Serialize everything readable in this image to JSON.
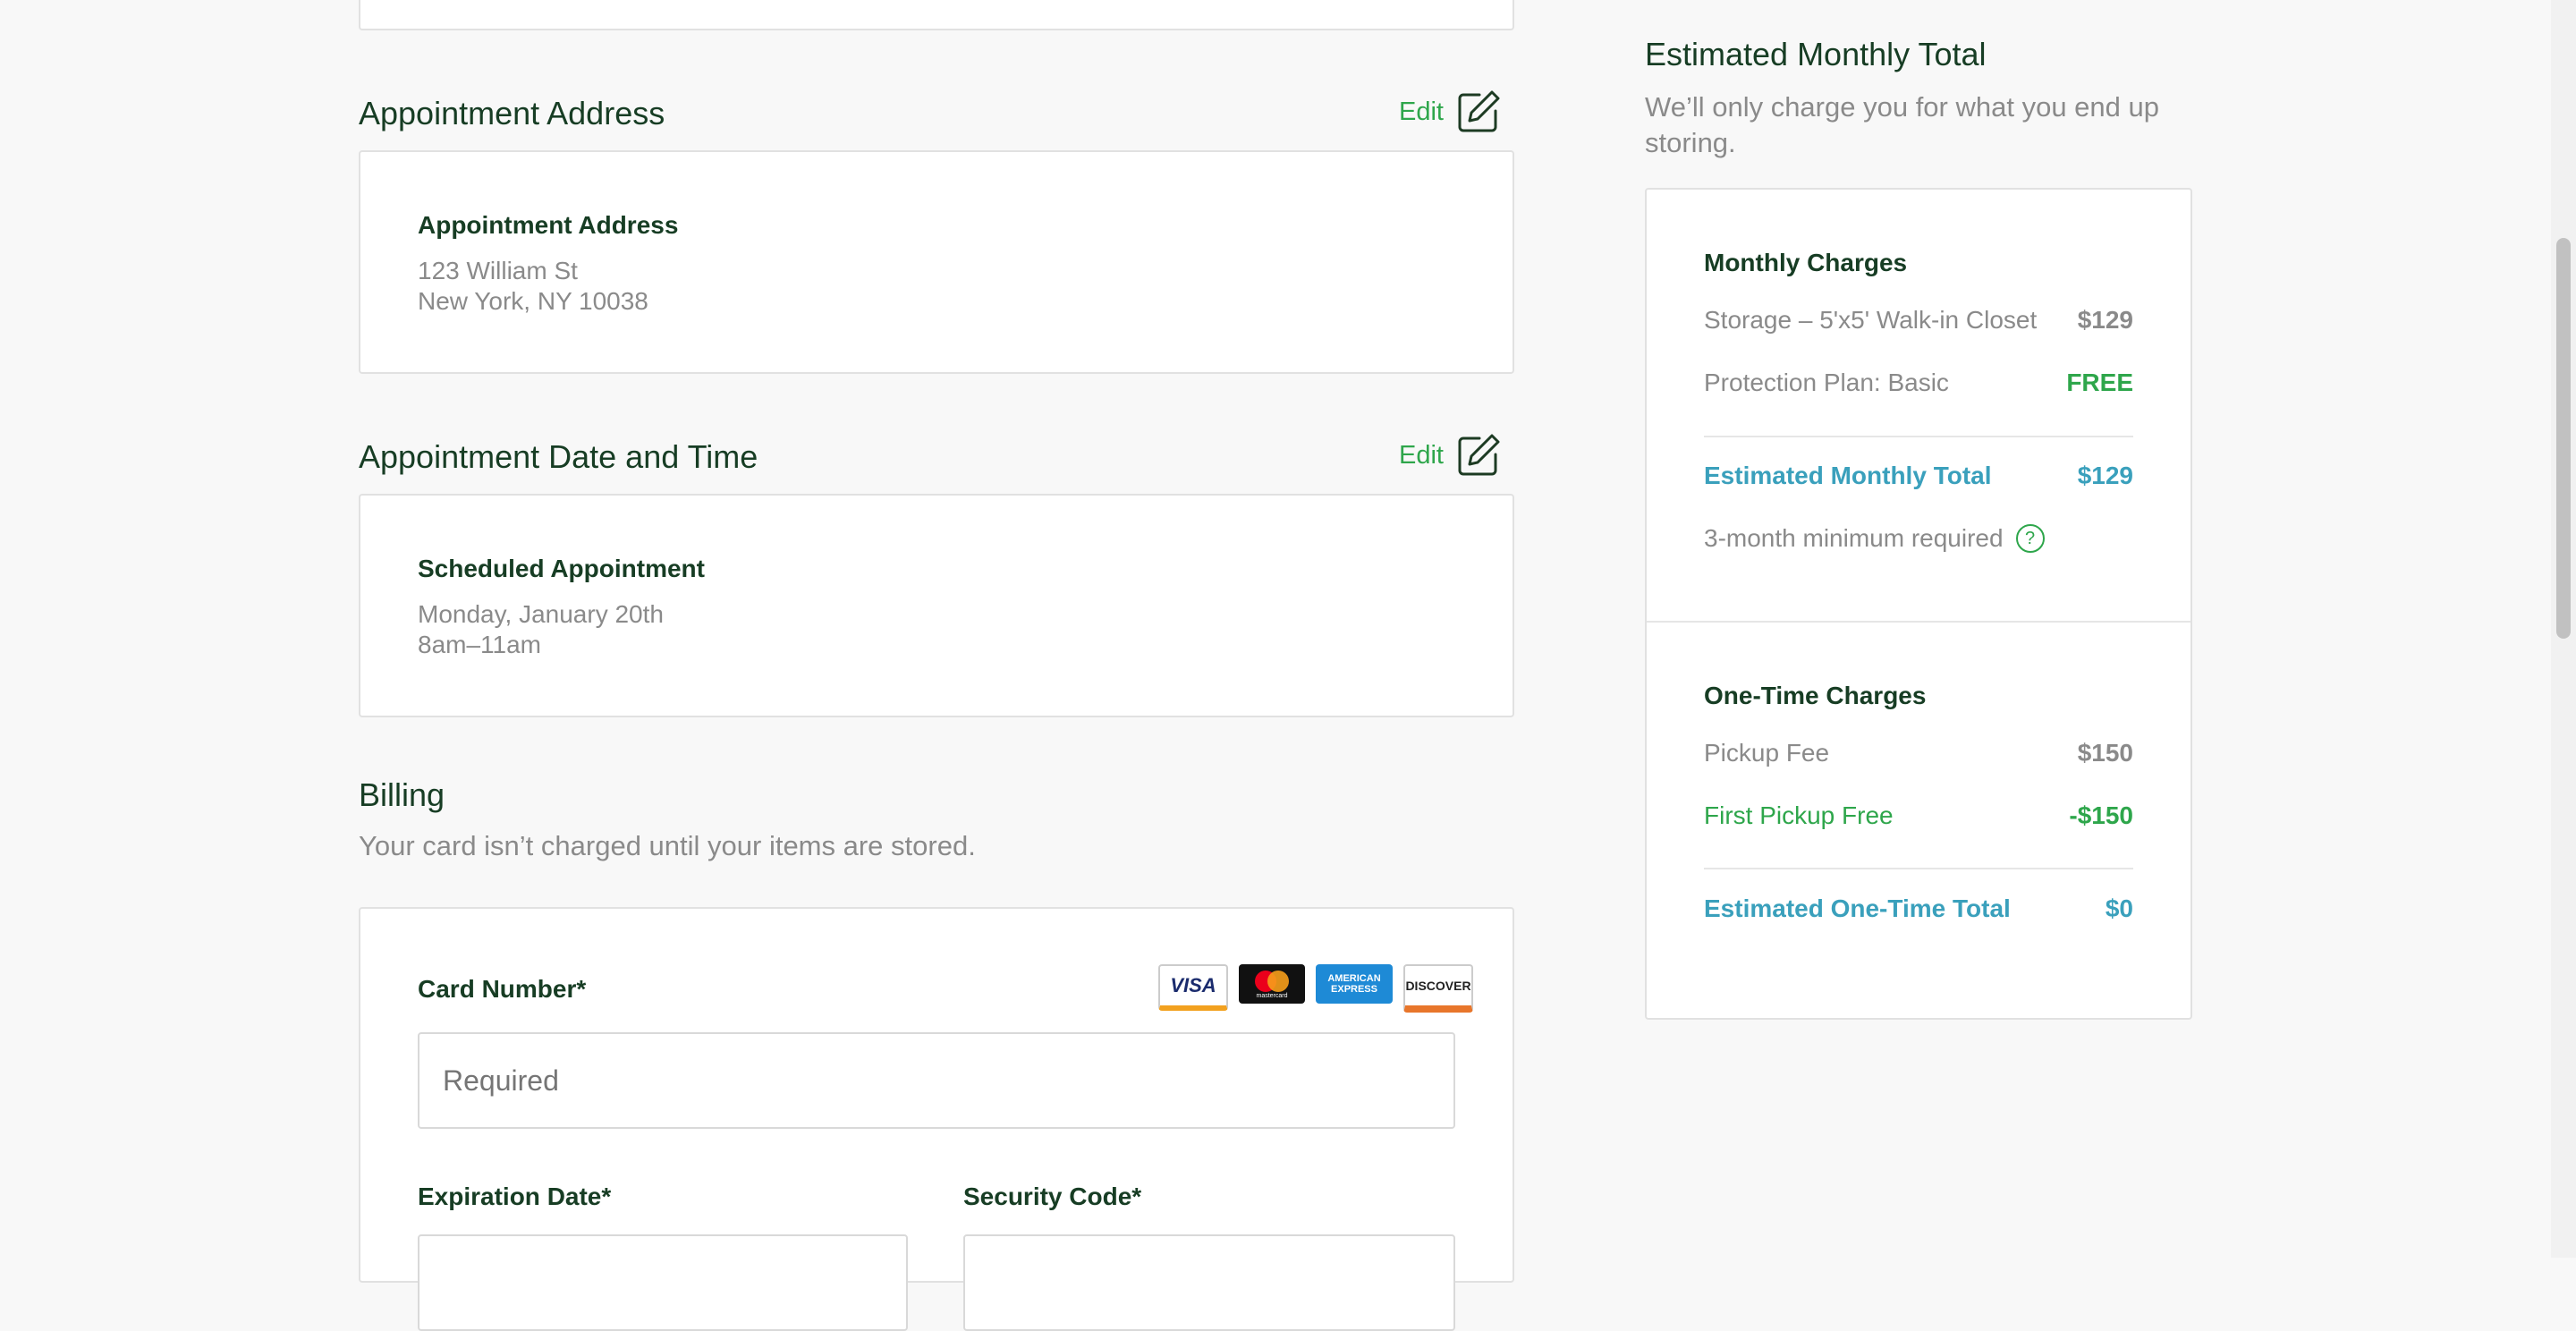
{
  "appointment_address": {
    "heading": "Appointment Address",
    "edit_label": "Edit",
    "card_title": "Appointment Address",
    "line1": "123 William St",
    "line2": "New York, NY 10038"
  },
  "appointment_time": {
    "heading": "Appointment Date and Time",
    "edit_label": "Edit",
    "card_title": "Scheduled Appointment",
    "line1": "Monday, January 20th",
    "line2": "8am–11am"
  },
  "billing": {
    "heading": "Billing",
    "subtext": "Your card isn’t charged until your items are stored.",
    "card_number_label": "Card Number*",
    "card_number_placeholder": "Required",
    "expiration_label": "Expiration Date*",
    "security_label": "Security Code*",
    "card_logos": [
      "VISA",
      "mastercard",
      "AMERICAN EXPRESS",
      "DISCOVER"
    ]
  },
  "summary": {
    "title": "Estimated Monthly Total",
    "subtitle": "We’ll only charge you for what you end up storing.",
    "monthly": {
      "title": "Monthly Charges",
      "items": [
        {
          "label": "Storage – 5'x5' Walk-in Closet",
          "amount": "$129"
        },
        {
          "label": "Protection Plan: Basic",
          "amount": "FREE"
        }
      ],
      "total_label": "Estimated Monthly Total",
      "total_amount": "$129",
      "minimum_note": "3-month minimum required",
      "help_icon": "?"
    },
    "one_time": {
      "title": "One-Time Charges",
      "items": [
        {
          "label": "Pickup Fee",
          "amount": "$150"
        },
        {
          "label": "First Pickup Free",
          "amount": "-$150"
        }
      ],
      "total_label": "Estimated One-Time Total",
      "total_amount": "$0"
    }
  },
  "colors": {
    "accent_green": "#2ea64b",
    "total_teal": "#3aa0bc",
    "heading_dark_green": "#173d24",
    "muted_text": "#8a8a8a"
  }
}
